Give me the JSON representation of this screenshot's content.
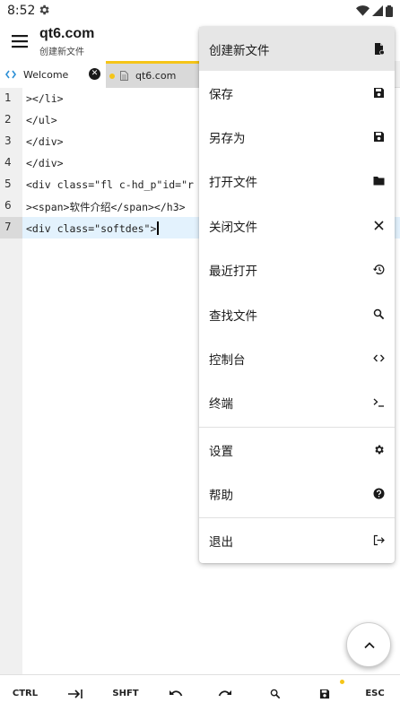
{
  "status_bar": {
    "time": "8:52"
  },
  "app_bar": {
    "title": "qt6.com",
    "subtitle": "创建新文件"
  },
  "tabs": [
    {
      "label": "Welcome"
    },
    {
      "label": "qt6.com"
    }
  ],
  "editor": {
    "lines": [
      {
        "num": "1",
        "code": "></li>"
      },
      {
        "num": "2",
        "code": "</ul>"
      },
      {
        "num": "3",
        "code": "</div>"
      },
      {
        "num": "4",
        "code": "</div>"
      },
      {
        "num": "5",
        "code": "<div class=\"fl c-hd_p\"id=\"r"
      },
      {
        "num": "6",
        "code": "><span>软件介绍</span></h3>"
      },
      {
        "num": "7",
        "code": "<div class=\"softdes\">"
      }
    ]
  },
  "menu": {
    "items": [
      {
        "label": "创建新文件",
        "icon": "new-file-icon"
      },
      {
        "label": "保存",
        "icon": "save-icon"
      },
      {
        "label": "另存为",
        "icon": "save-as-icon"
      },
      {
        "label": "打开文件",
        "icon": "folder-icon"
      },
      {
        "label": "关闭文件",
        "icon": "close-icon"
      },
      {
        "label": "最近打开",
        "icon": "history-icon"
      },
      {
        "label": "查找文件",
        "icon": "search-icon"
      },
      {
        "label": "控制台",
        "icon": "code-icon"
      },
      {
        "label": "终端",
        "icon": "terminal-icon"
      },
      {
        "label": "设置",
        "icon": "gear-icon"
      },
      {
        "label": "帮助",
        "icon": "help-icon"
      },
      {
        "label": "退出",
        "icon": "exit-icon"
      }
    ]
  },
  "toolbar": {
    "ctrl": "CTRL",
    "shft": "SHFT",
    "esc": "ESC"
  },
  "colors": {
    "accent_tab": "#f5c518",
    "active_line": "#e3f2fd",
    "menu_highlight": "#e6e6e6"
  }
}
